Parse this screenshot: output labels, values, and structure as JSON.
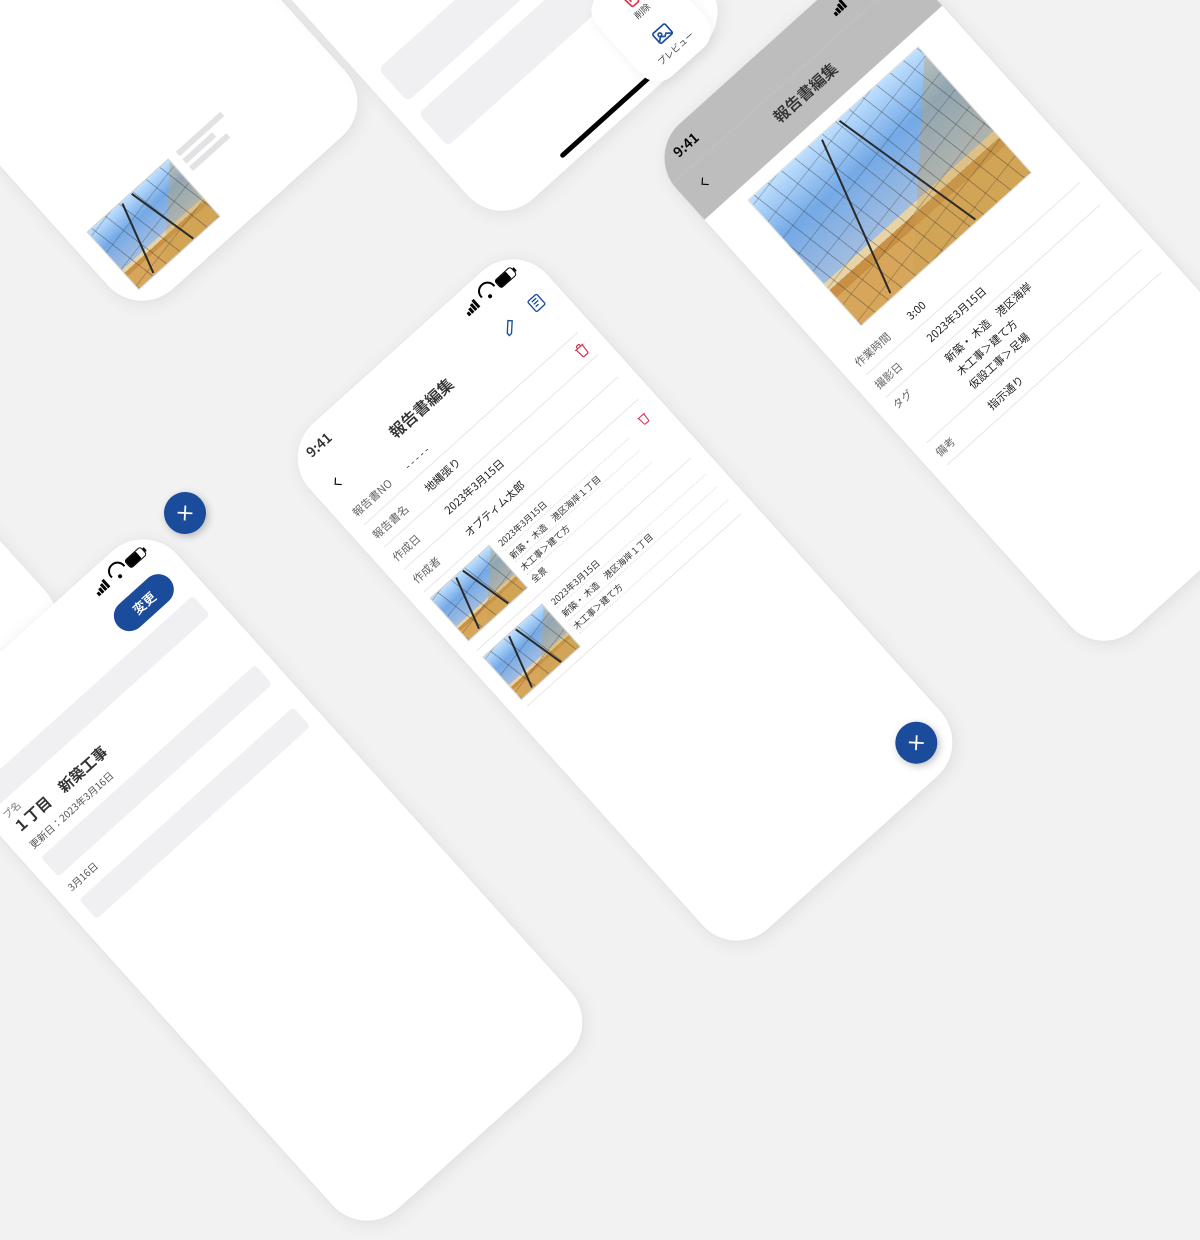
{
  "statusTime": "9:41",
  "screenTitle": "報告書編集",
  "form": {
    "reportNoLabel": "報告書NO",
    "reportNo": "- - - - -",
    "reportNameLabel": "報告書名",
    "reportName": "地縄張り",
    "createdDateLabel": "作成日",
    "createdDate": "2023年3月15日",
    "authorLabel": "作成者",
    "author": "オプティム太郎"
  },
  "photoItems": [
    {
      "date": "2023年3月15日",
      "tags": "新築・ 木造　港区海岸１丁目",
      "work": "木工事＞建て方",
      "note": "全景"
    },
    {
      "date": "2023年3月15日",
      "tags": "新築・ 木造　港区海岸１丁目",
      "work": "木工事＞建て方",
      "note": ""
    }
  ],
  "detail": {
    "workTimeLabel": "作業時間",
    "workTime": "3:00",
    "shotDateLabel": "撮影日",
    "shotDate": "2023年3月15日",
    "tagLabel": "タグ",
    "tagLine1": "新築・ 木造　港区海岸",
    "tagLine2": "木工事＞建て方",
    "tagLine3": "仮設工事＞足場",
    "remarkLabel": "備考",
    "remark": "指示通り"
  },
  "actions": {
    "delete": "削除",
    "preview": "プレビュー"
  },
  "project": {
    "titleSuffix": "１丁目　新築工事",
    "updatedPrefix": "更新日：",
    "updatedA": "2023年3月16日",
    "updatedB": "3月16日",
    "label": "プ名"
  },
  "buttons": {
    "change": "変更"
  }
}
